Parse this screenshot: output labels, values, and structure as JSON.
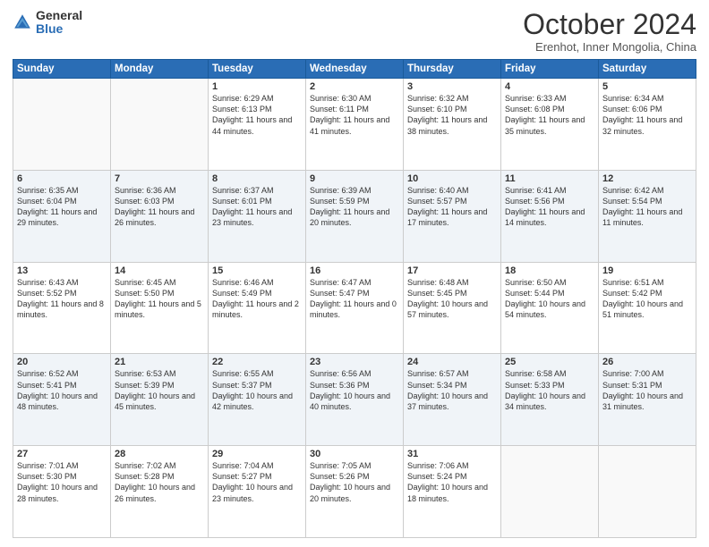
{
  "logo": {
    "general": "General",
    "blue": "Blue"
  },
  "header": {
    "month": "October 2024",
    "location": "Erenhot, Inner Mongolia, China"
  },
  "days_of_week": [
    "Sunday",
    "Monday",
    "Tuesday",
    "Wednesday",
    "Thursday",
    "Friday",
    "Saturday"
  ],
  "weeks": [
    [
      {
        "day": "",
        "sunrise": "",
        "sunset": "",
        "daylight": ""
      },
      {
        "day": "",
        "sunrise": "",
        "sunset": "",
        "daylight": ""
      },
      {
        "day": "1",
        "sunrise": "Sunrise: 6:29 AM",
        "sunset": "Sunset: 6:13 PM",
        "daylight": "Daylight: 11 hours and 44 minutes."
      },
      {
        "day": "2",
        "sunrise": "Sunrise: 6:30 AM",
        "sunset": "Sunset: 6:11 PM",
        "daylight": "Daylight: 11 hours and 41 minutes."
      },
      {
        "day": "3",
        "sunrise": "Sunrise: 6:32 AM",
        "sunset": "Sunset: 6:10 PM",
        "daylight": "Daylight: 11 hours and 38 minutes."
      },
      {
        "day": "4",
        "sunrise": "Sunrise: 6:33 AM",
        "sunset": "Sunset: 6:08 PM",
        "daylight": "Daylight: 11 hours and 35 minutes."
      },
      {
        "day": "5",
        "sunrise": "Sunrise: 6:34 AM",
        "sunset": "Sunset: 6:06 PM",
        "daylight": "Daylight: 11 hours and 32 minutes."
      }
    ],
    [
      {
        "day": "6",
        "sunrise": "Sunrise: 6:35 AM",
        "sunset": "Sunset: 6:04 PM",
        "daylight": "Daylight: 11 hours and 29 minutes."
      },
      {
        "day": "7",
        "sunrise": "Sunrise: 6:36 AM",
        "sunset": "Sunset: 6:03 PM",
        "daylight": "Daylight: 11 hours and 26 minutes."
      },
      {
        "day": "8",
        "sunrise": "Sunrise: 6:37 AM",
        "sunset": "Sunset: 6:01 PM",
        "daylight": "Daylight: 11 hours and 23 minutes."
      },
      {
        "day": "9",
        "sunrise": "Sunrise: 6:39 AM",
        "sunset": "Sunset: 5:59 PM",
        "daylight": "Daylight: 11 hours and 20 minutes."
      },
      {
        "day": "10",
        "sunrise": "Sunrise: 6:40 AM",
        "sunset": "Sunset: 5:57 PM",
        "daylight": "Daylight: 11 hours and 17 minutes."
      },
      {
        "day": "11",
        "sunrise": "Sunrise: 6:41 AM",
        "sunset": "Sunset: 5:56 PM",
        "daylight": "Daylight: 11 hours and 14 minutes."
      },
      {
        "day": "12",
        "sunrise": "Sunrise: 6:42 AM",
        "sunset": "Sunset: 5:54 PM",
        "daylight": "Daylight: 11 hours and 11 minutes."
      }
    ],
    [
      {
        "day": "13",
        "sunrise": "Sunrise: 6:43 AM",
        "sunset": "Sunset: 5:52 PM",
        "daylight": "Daylight: 11 hours and 8 minutes."
      },
      {
        "day": "14",
        "sunrise": "Sunrise: 6:45 AM",
        "sunset": "Sunset: 5:50 PM",
        "daylight": "Daylight: 11 hours and 5 minutes."
      },
      {
        "day": "15",
        "sunrise": "Sunrise: 6:46 AM",
        "sunset": "Sunset: 5:49 PM",
        "daylight": "Daylight: 11 hours and 2 minutes."
      },
      {
        "day": "16",
        "sunrise": "Sunrise: 6:47 AM",
        "sunset": "Sunset: 5:47 PM",
        "daylight": "Daylight: 11 hours and 0 minutes."
      },
      {
        "day": "17",
        "sunrise": "Sunrise: 6:48 AM",
        "sunset": "Sunset: 5:45 PM",
        "daylight": "Daylight: 10 hours and 57 minutes."
      },
      {
        "day": "18",
        "sunrise": "Sunrise: 6:50 AM",
        "sunset": "Sunset: 5:44 PM",
        "daylight": "Daylight: 10 hours and 54 minutes."
      },
      {
        "day": "19",
        "sunrise": "Sunrise: 6:51 AM",
        "sunset": "Sunset: 5:42 PM",
        "daylight": "Daylight: 10 hours and 51 minutes."
      }
    ],
    [
      {
        "day": "20",
        "sunrise": "Sunrise: 6:52 AM",
        "sunset": "Sunset: 5:41 PM",
        "daylight": "Daylight: 10 hours and 48 minutes."
      },
      {
        "day": "21",
        "sunrise": "Sunrise: 6:53 AM",
        "sunset": "Sunset: 5:39 PM",
        "daylight": "Daylight: 10 hours and 45 minutes."
      },
      {
        "day": "22",
        "sunrise": "Sunrise: 6:55 AM",
        "sunset": "Sunset: 5:37 PM",
        "daylight": "Daylight: 10 hours and 42 minutes."
      },
      {
        "day": "23",
        "sunrise": "Sunrise: 6:56 AM",
        "sunset": "Sunset: 5:36 PM",
        "daylight": "Daylight: 10 hours and 40 minutes."
      },
      {
        "day": "24",
        "sunrise": "Sunrise: 6:57 AM",
        "sunset": "Sunset: 5:34 PM",
        "daylight": "Daylight: 10 hours and 37 minutes."
      },
      {
        "day": "25",
        "sunrise": "Sunrise: 6:58 AM",
        "sunset": "Sunset: 5:33 PM",
        "daylight": "Daylight: 10 hours and 34 minutes."
      },
      {
        "day": "26",
        "sunrise": "Sunrise: 7:00 AM",
        "sunset": "Sunset: 5:31 PM",
        "daylight": "Daylight: 10 hours and 31 minutes."
      }
    ],
    [
      {
        "day": "27",
        "sunrise": "Sunrise: 7:01 AM",
        "sunset": "Sunset: 5:30 PM",
        "daylight": "Daylight: 10 hours and 28 minutes."
      },
      {
        "day": "28",
        "sunrise": "Sunrise: 7:02 AM",
        "sunset": "Sunset: 5:28 PM",
        "daylight": "Daylight: 10 hours and 26 minutes."
      },
      {
        "day": "29",
        "sunrise": "Sunrise: 7:04 AM",
        "sunset": "Sunset: 5:27 PM",
        "daylight": "Daylight: 10 hours and 23 minutes."
      },
      {
        "day": "30",
        "sunrise": "Sunrise: 7:05 AM",
        "sunset": "Sunset: 5:26 PM",
        "daylight": "Daylight: 10 hours and 20 minutes."
      },
      {
        "day": "31",
        "sunrise": "Sunrise: 7:06 AM",
        "sunset": "Sunset: 5:24 PM",
        "daylight": "Daylight: 10 hours and 18 minutes."
      },
      {
        "day": "",
        "sunrise": "",
        "sunset": "",
        "daylight": ""
      },
      {
        "day": "",
        "sunrise": "",
        "sunset": "",
        "daylight": ""
      }
    ]
  ]
}
